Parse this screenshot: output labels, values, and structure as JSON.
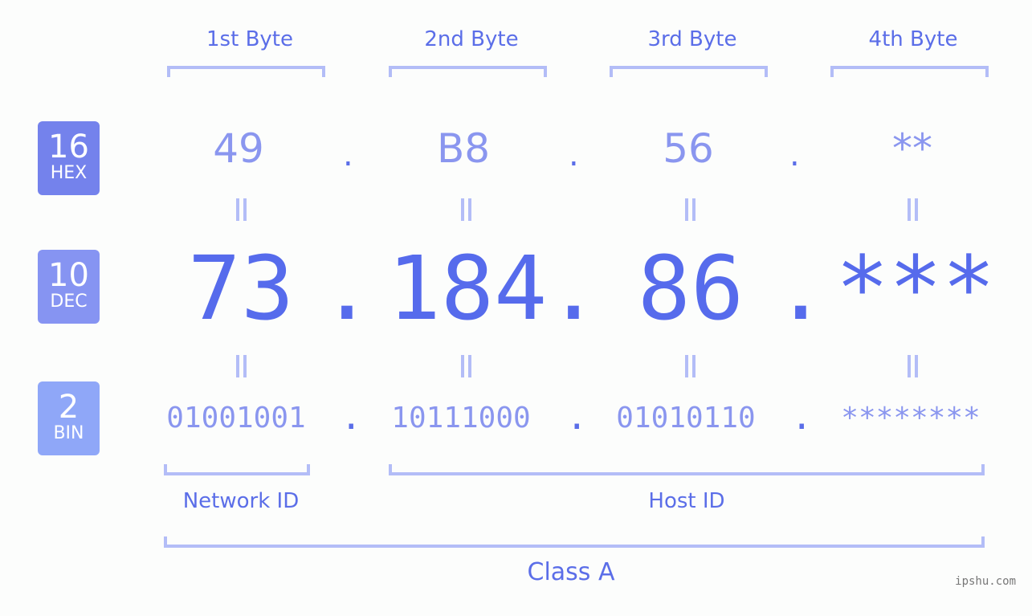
{
  "byte_headers": [
    "1st Byte",
    "2nd Byte",
    "3rd Byte",
    "4th Byte"
  ],
  "badges": {
    "hex": {
      "base": "16",
      "label": "HEX",
      "color": "#7482ec"
    },
    "dec": {
      "base": "10",
      "label": "DEC",
      "color": "#8694f2"
    },
    "bin": {
      "base": "2",
      "label": "BIN",
      "color": "#8fa7f8"
    }
  },
  "hex_values": [
    "49",
    "B8",
    "56",
    "**"
  ],
  "dec_values": [
    "73",
    "184",
    "86",
    "***"
  ],
  "bin_values": [
    "01001001",
    "10111000",
    "01010110",
    "********"
  ],
  "separator": ".",
  "network_id_label": "Network ID",
  "host_id_label": "Host ID",
  "class_label": "Class A",
  "watermark": "ipshu.com"
}
